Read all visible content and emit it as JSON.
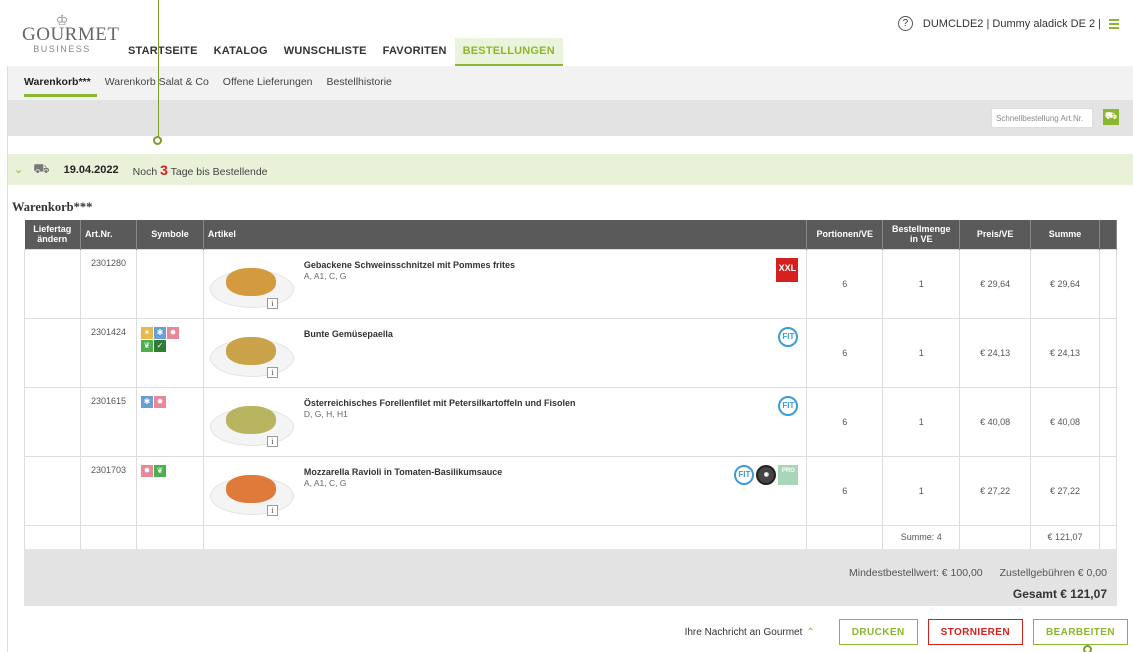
{
  "header": {
    "logo_line1": "GOURMET",
    "logo_line2": "BUSINESS",
    "user_label": "DUMCLDE2 | Dummy aladick DE 2 |",
    "help_label": "?"
  },
  "nav": [
    "STARTSEITE",
    "KATALOG",
    "WUNSCHLISTE",
    "FAVORITEN",
    "BESTELLUNGEN"
  ],
  "subnav": [
    "Warenkorb***",
    "Warenkorb Salat & Co",
    "Offene Lieferungen",
    "Bestellhistorie"
  ],
  "quick_order": {
    "placeholder": "Schnellbestellung Art.Nr."
  },
  "delivery": {
    "date": "19.04.2022",
    "prefix": "Noch",
    "days": "3",
    "suffix": "Tage bis Bestellende"
  },
  "cart_title": "Warenkorb***",
  "table": {
    "headers": [
      "Liefertag ändern",
      "Art.Nr.",
      "Symbole",
      "Artikel",
      "Portionen/VE",
      "Bestellmenge in VE",
      "Preis/VE",
      "Summe"
    ],
    "rows": [
      {
        "art_nr": "2301280",
        "name": "Gebackene Schweinsschnitzel mit Pommes frites",
        "allergens": "A, A1, C, G",
        "portions": "6",
        "qty": "1",
        "price": "€ 29,64",
        "sum": "€ 29,64"
      },
      {
        "art_nr": "2301424",
        "name": "Bunte Gemüsepaella",
        "allergens": "",
        "portions": "6",
        "qty": "1",
        "price": "€ 24,13",
        "sum": "€ 24,13"
      },
      {
        "art_nr": "2301615",
        "name": "Österreichisches Forellenfilet mit Petersilkartoffeln und Fisolen",
        "allergens": "D, G, H, H1",
        "portions": "6",
        "qty": "1",
        "price": "€ 40,08",
        "sum": "€ 40,08"
      },
      {
        "art_nr": "2301703",
        "name": "Mozzarella Ravioli in Tomaten-Basilikumsauce",
        "allergens": "A, A1, C, G",
        "portions": "6",
        "qty": "1",
        "price": "€ 27,22",
        "sum": "€ 27,22"
      }
    ],
    "sum_qty": "Summe: 4",
    "sum_total": "€ 121,07"
  },
  "badges": {
    "xxl": "XXL",
    "fit": "FIT",
    "pro": "PRO"
  },
  "footer": {
    "min_order": "Mindestbestellwert: € 100,00",
    "delivery_fee": "Zustellgebühren € 0,00",
    "total": "Gesamt € 121,07"
  },
  "actions": {
    "message": "Ihre Nachricht an Gourmet",
    "print": "DRUCKEN",
    "cancel": "STORNIEREN",
    "edit": "BEARBEITEN"
  }
}
